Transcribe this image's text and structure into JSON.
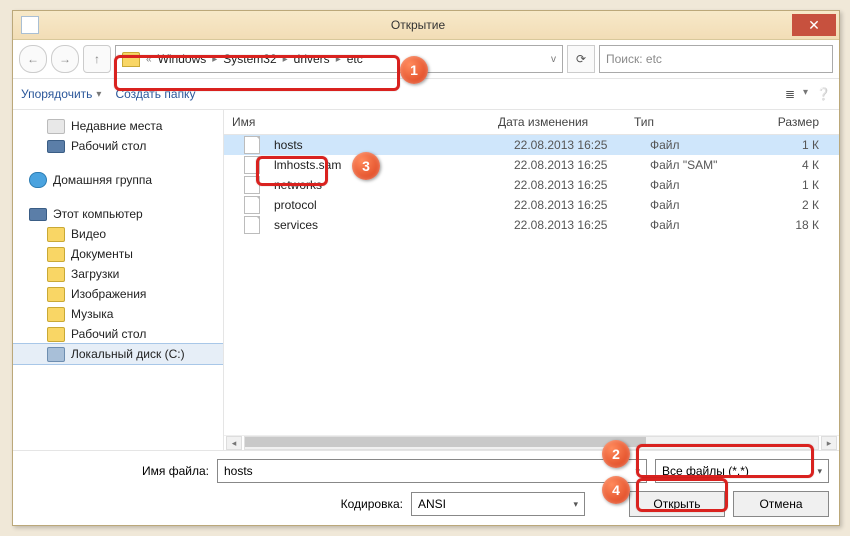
{
  "titlebar": {
    "title": "Открытие"
  },
  "nav": {
    "crumbs_prefix": "«",
    "crumbs": [
      "Windows",
      "System32",
      "drivers",
      "etc"
    ],
    "dropdown_caret": "v",
    "search_placeholder": "Поиск: etc"
  },
  "toolbar": {
    "organize": "Упорядочить",
    "newfolder": "Создать папку"
  },
  "tree": {
    "recent": "Недавние места",
    "desktop": "Рабочий стол",
    "homegroup": "Домашняя группа",
    "thispc": "Этот компьютер",
    "video": "Видео",
    "documents": "Документы",
    "downloads": "Загрузки",
    "pictures": "Изображения",
    "music": "Музыка",
    "deskfolder": "Рабочий стол",
    "localdisk": "Локальный диск (C:)"
  },
  "columns": {
    "name": "Имя",
    "date": "Дата изменения",
    "type": "Тип",
    "size": "Размер"
  },
  "files": [
    {
      "name": "hosts",
      "date": "22.08.2013 16:25",
      "type": "Файл",
      "size": "1 К",
      "selected": true
    },
    {
      "name": "lmhosts.sam",
      "date": "22.08.2013 16:25",
      "type": "Файл \"SAM\"",
      "size": "4 К",
      "selected": false
    },
    {
      "name": "networks",
      "date": "22.08.2013 16:25",
      "type": "Файл",
      "size": "1 К",
      "selected": false
    },
    {
      "name": "protocol",
      "date": "22.08.2013 16:25",
      "type": "Файл",
      "size": "2 К",
      "selected": false
    },
    {
      "name": "services",
      "date": "22.08.2013 16:25",
      "type": "Файл",
      "size": "18 К",
      "selected": false
    }
  ],
  "footer": {
    "filename_label": "Имя файла:",
    "filename_value": "hosts",
    "filter_value": "Все файлы  (*.*)",
    "encoding_label": "Кодировка:",
    "encoding_value": "ANSI",
    "open": "Открыть",
    "cancel": "Отмена"
  },
  "annotations": {
    "b1": "1",
    "b2": "2",
    "b3": "3",
    "b4": "4"
  }
}
